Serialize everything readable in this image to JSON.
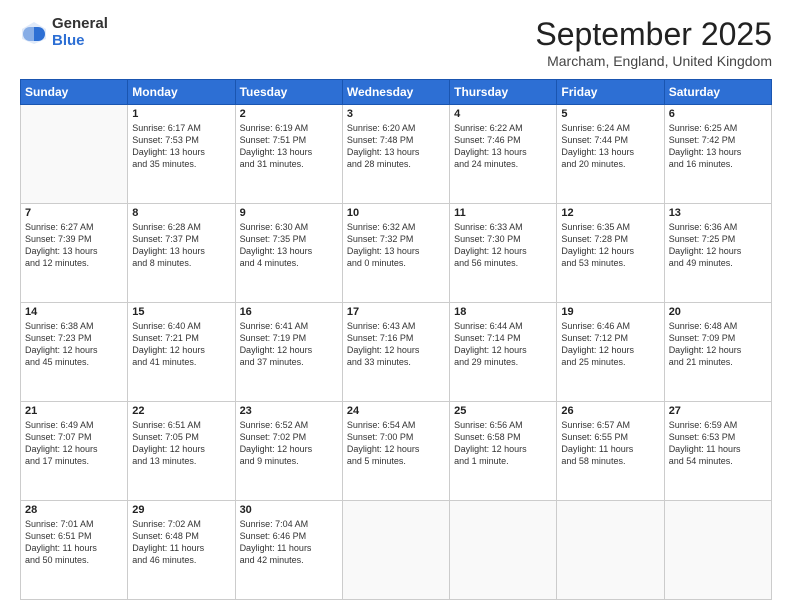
{
  "logo": {
    "general": "General",
    "blue": "Blue"
  },
  "title": "September 2025",
  "location": "Marcham, England, United Kingdom",
  "days": [
    "Sunday",
    "Monday",
    "Tuesday",
    "Wednesday",
    "Thursday",
    "Friday",
    "Saturday"
  ],
  "weeks": [
    [
      {
        "num": "",
        "lines": []
      },
      {
        "num": "1",
        "lines": [
          "Sunrise: 6:17 AM",
          "Sunset: 7:53 PM",
          "Daylight: 13 hours",
          "and 35 minutes."
        ]
      },
      {
        "num": "2",
        "lines": [
          "Sunrise: 6:19 AM",
          "Sunset: 7:51 PM",
          "Daylight: 13 hours",
          "and 31 minutes."
        ]
      },
      {
        "num": "3",
        "lines": [
          "Sunrise: 6:20 AM",
          "Sunset: 7:48 PM",
          "Daylight: 13 hours",
          "and 28 minutes."
        ]
      },
      {
        "num": "4",
        "lines": [
          "Sunrise: 6:22 AM",
          "Sunset: 7:46 PM",
          "Daylight: 13 hours",
          "and 24 minutes."
        ]
      },
      {
        "num": "5",
        "lines": [
          "Sunrise: 6:24 AM",
          "Sunset: 7:44 PM",
          "Daylight: 13 hours",
          "and 20 minutes."
        ]
      },
      {
        "num": "6",
        "lines": [
          "Sunrise: 6:25 AM",
          "Sunset: 7:42 PM",
          "Daylight: 13 hours",
          "and 16 minutes."
        ]
      }
    ],
    [
      {
        "num": "7",
        "lines": [
          "Sunrise: 6:27 AM",
          "Sunset: 7:39 PM",
          "Daylight: 13 hours",
          "and 12 minutes."
        ]
      },
      {
        "num": "8",
        "lines": [
          "Sunrise: 6:28 AM",
          "Sunset: 7:37 PM",
          "Daylight: 13 hours",
          "and 8 minutes."
        ]
      },
      {
        "num": "9",
        "lines": [
          "Sunrise: 6:30 AM",
          "Sunset: 7:35 PM",
          "Daylight: 13 hours",
          "and 4 minutes."
        ]
      },
      {
        "num": "10",
        "lines": [
          "Sunrise: 6:32 AM",
          "Sunset: 7:32 PM",
          "Daylight: 13 hours",
          "and 0 minutes."
        ]
      },
      {
        "num": "11",
        "lines": [
          "Sunrise: 6:33 AM",
          "Sunset: 7:30 PM",
          "Daylight: 12 hours",
          "and 56 minutes."
        ]
      },
      {
        "num": "12",
        "lines": [
          "Sunrise: 6:35 AM",
          "Sunset: 7:28 PM",
          "Daylight: 12 hours",
          "and 53 minutes."
        ]
      },
      {
        "num": "13",
        "lines": [
          "Sunrise: 6:36 AM",
          "Sunset: 7:25 PM",
          "Daylight: 12 hours",
          "and 49 minutes."
        ]
      }
    ],
    [
      {
        "num": "14",
        "lines": [
          "Sunrise: 6:38 AM",
          "Sunset: 7:23 PM",
          "Daylight: 12 hours",
          "and 45 minutes."
        ]
      },
      {
        "num": "15",
        "lines": [
          "Sunrise: 6:40 AM",
          "Sunset: 7:21 PM",
          "Daylight: 12 hours",
          "and 41 minutes."
        ]
      },
      {
        "num": "16",
        "lines": [
          "Sunrise: 6:41 AM",
          "Sunset: 7:19 PM",
          "Daylight: 12 hours",
          "and 37 minutes."
        ]
      },
      {
        "num": "17",
        "lines": [
          "Sunrise: 6:43 AM",
          "Sunset: 7:16 PM",
          "Daylight: 12 hours",
          "and 33 minutes."
        ]
      },
      {
        "num": "18",
        "lines": [
          "Sunrise: 6:44 AM",
          "Sunset: 7:14 PM",
          "Daylight: 12 hours",
          "and 29 minutes."
        ]
      },
      {
        "num": "19",
        "lines": [
          "Sunrise: 6:46 AM",
          "Sunset: 7:12 PM",
          "Daylight: 12 hours",
          "and 25 minutes."
        ]
      },
      {
        "num": "20",
        "lines": [
          "Sunrise: 6:48 AM",
          "Sunset: 7:09 PM",
          "Daylight: 12 hours",
          "and 21 minutes."
        ]
      }
    ],
    [
      {
        "num": "21",
        "lines": [
          "Sunrise: 6:49 AM",
          "Sunset: 7:07 PM",
          "Daylight: 12 hours",
          "and 17 minutes."
        ]
      },
      {
        "num": "22",
        "lines": [
          "Sunrise: 6:51 AM",
          "Sunset: 7:05 PM",
          "Daylight: 12 hours",
          "and 13 minutes."
        ]
      },
      {
        "num": "23",
        "lines": [
          "Sunrise: 6:52 AM",
          "Sunset: 7:02 PM",
          "Daylight: 12 hours",
          "and 9 minutes."
        ]
      },
      {
        "num": "24",
        "lines": [
          "Sunrise: 6:54 AM",
          "Sunset: 7:00 PM",
          "Daylight: 12 hours",
          "and 5 minutes."
        ]
      },
      {
        "num": "25",
        "lines": [
          "Sunrise: 6:56 AM",
          "Sunset: 6:58 PM",
          "Daylight: 12 hours",
          "and 1 minute."
        ]
      },
      {
        "num": "26",
        "lines": [
          "Sunrise: 6:57 AM",
          "Sunset: 6:55 PM",
          "Daylight: 11 hours",
          "and 58 minutes."
        ]
      },
      {
        "num": "27",
        "lines": [
          "Sunrise: 6:59 AM",
          "Sunset: 6:53 PM",
          "Daylight: 11 hours",
          "and 54 minutes."
        ]
      }
    ],
    [
      {
        "num": "28",
        "lines": [
          "Sunrise: 7:01 AM",
          "Sunset: 6:51 PM",
          "Daylight: 11 hours",
          "and 50 minutes."
        ]
      },
      {
        "num": "29",
        "lines": [
          "Sunrise: 7:02 AM",
          "Sunset: 6:48 PM",
          "Daylight: 11 hours",
          "and 46 minutes."
        ]
      },
      {
        "num": "30",
        "lines": [
          "Sunrise: 7:04 AM",
          "Sunset: 6:46 PM",
          "Daylight: 11 hours",
          "and 42 minutes."
        ]
      },
      {
        "num": "",
        "lines": []
      },
      {
        "num": "",
        "lines": []
      },
      {
        "num": "",
        "lines": []
      },
      {
        "num": "",
        "lines": []
      }
    ]
  ]
}
